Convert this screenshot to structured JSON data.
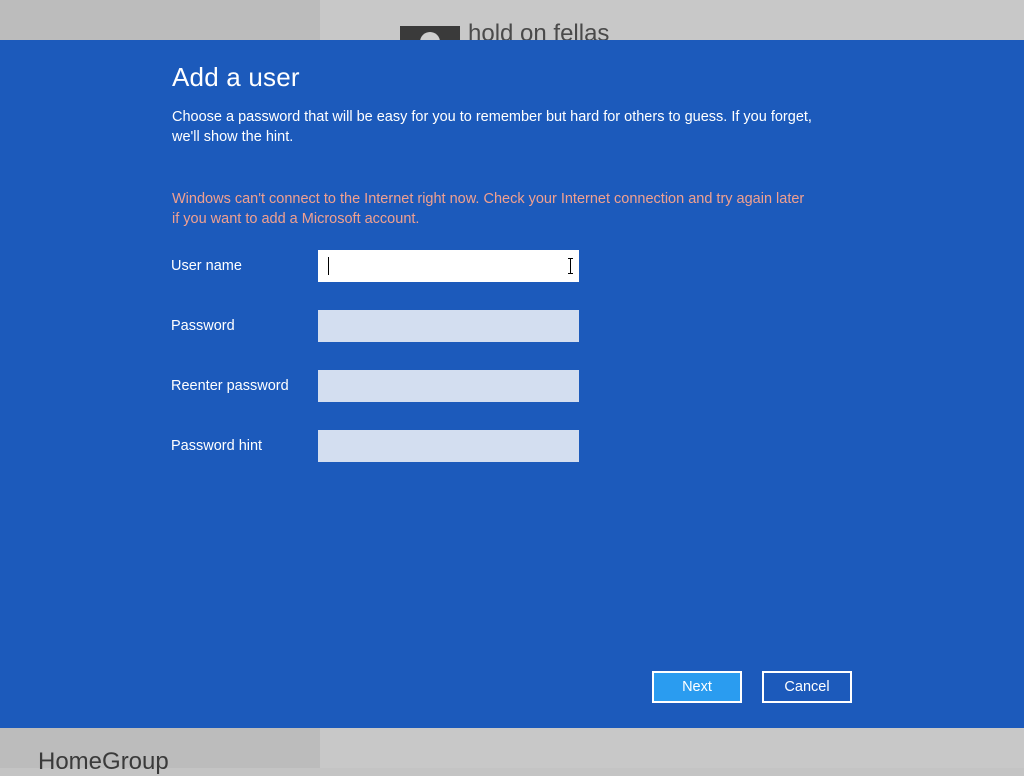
{
  "background": {
    "account_name": "hold on fellas",
    "homegroup_label": "HomeGroup"
  },
  "dialog": {
    "title": "Add a user",
    "description": "Choose a password that will be easy for you to remember but hard for others to guess. If you forget, we'll show the hint.",
    "error": "Windows can't connect to the Internet right now. Check your Internet connection and try again later if you want to add a Microsoft account.",
    "fields": [
      {
        "label": "User name",
        "value": ""
      },
      {
        "label": "Password",
        "value": ""
      },
      {
        "label": "Reenter password",
        "value": ""
      },
      {
        "label": "Password hint",
        "value": ""
      }
    ],
    "buttons": {
      "next": "Next",
      "cancel": "Cancel"
    }
  },
  "colors": {
    "dialog_background": "#1c5abb",
    "error_text": "#f0a090",
    "next_button": "#2a9cf0"
  }
}
